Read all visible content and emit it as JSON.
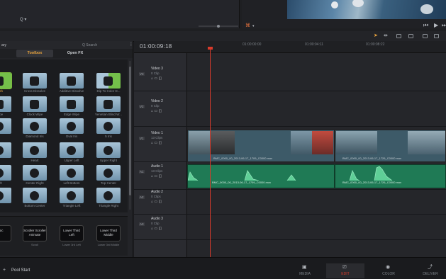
{
  "top": {
    "left_glyph": "Q ▾"
  },
  "effects_panel": {
    "header_left": "ary",
    "search_placeholder": "Q Search",
    "tabs": [
      {
        "label": "Toolbox",
        "active": true
      },
      {
        "label": "Open FX",
        "active": false
      }
    ],
    "tiles": [
      {
        "label": "fresh"
      },
      {
        "label": "Cross Dissolve"
      },
      {
        "label": "Additive Dissolve"
      },
      {
        "label": "Dip To Color D..."
      },
      {
        "label": "Wipe"
      },
      {
        "label": "Clock Wipe"
      },
      {
        "label": "Edge Wipe"
      },
      {
        "label": "Venetian Blind W..."
      },
      {
        "label": ""
      },
      {
        "label": "Diamond Iris"
      },
      {
        "label": "Oval Iris"
      },
      {
        "label": "5 Iris"
      },
      {
        "label": ""
      },
      {
        "label": "Heart"
      },
      {
        "label": "Upper Left"
      },
      {
        "label": "Upper Right"
      },
      {
        "label": "Left"
      },
      {
        "label": "Center Right"
      },
      {
        "label": "Left Bottom"
      },
      {
        "label": "Top Center"
      },
      {
        "label": ""
      },
      {
        "label": "Bottom Center"
      },
      {
        "label": "Triangle Left"
      },
      {
        "label": "Triangle Right"
      }
    ],
    "dark_tiles": [
      {
        "text": "Basic",
        "label": ""
      },
      {
        "text": "Scroller Scroller Animate",
        "label": "Scroll"
      },
      {
        "text": "Lower Third Left",
        "label": "Lower 3rd Left"
      },
      {
        "text": "Lower Third Middle",
        "label": "Lower 3rd Middle"
      }
    ]
  },
  "timeline": {
    "timecode": "01:00:09:18",
    "ruler_ticks": [
      "01:00:00:00",
      "01:00:04:11",
      "01:00:08:22"
    ],
    "tracks": [
      {
        "id": "V3",
        "name": "Video 3",
        "clips": "0 Clip"
      },
      {
        "id": "V2",
        "name": "Video 2",
        "clips": "0 Clip"
      },
      {
        "id": "V1",
        "name": "Video 1",
        "clips": "13 Clips"
      },
      {
        "id": "A1",
        "name": "Audio 1",
        "clips": "13 Clips"
      },
      {
        "id": "A2",
        "name": "Audio 2",
        "clips": "0 Clips"
      },
      {
        "id": "A3",
        "name": "Audio 3",
        "clips": "0 Clip"
      }
    ],
    "video_clip_names": [
      "BMC_0000_00_2013-06-17_1709_C0000.mov",
      "BMC_0000_00_2013-06-17_1726_C0000.mov"
    ],
    "audio_clip_names": [
      "BMC_0000_00_2013-06-17_1709_C0000.mov",
      "BMC_0000_00_2013-06-17_1726_C0000.mov"
    ]
  },
  "bottom_bar": {
    "pool_label": "Pool Start",
    "pages": [
      {
        "label": "MEDIA",
        "active": false
      },
      {
        "label": "EDIT",
        "active": true
      },
      {
        "label": "COLOR",
        "active": false
      },
      {
        "label": "DELIVER",
        "active": false
      }
    ]
  },
  "colors": {
    "accent_orange": "#e8a33d",
    "playhead_red": "#d93b2b",
    "audio_green": "#1f7a55",
    "video_clip": "#3d5a68"
  }
}
